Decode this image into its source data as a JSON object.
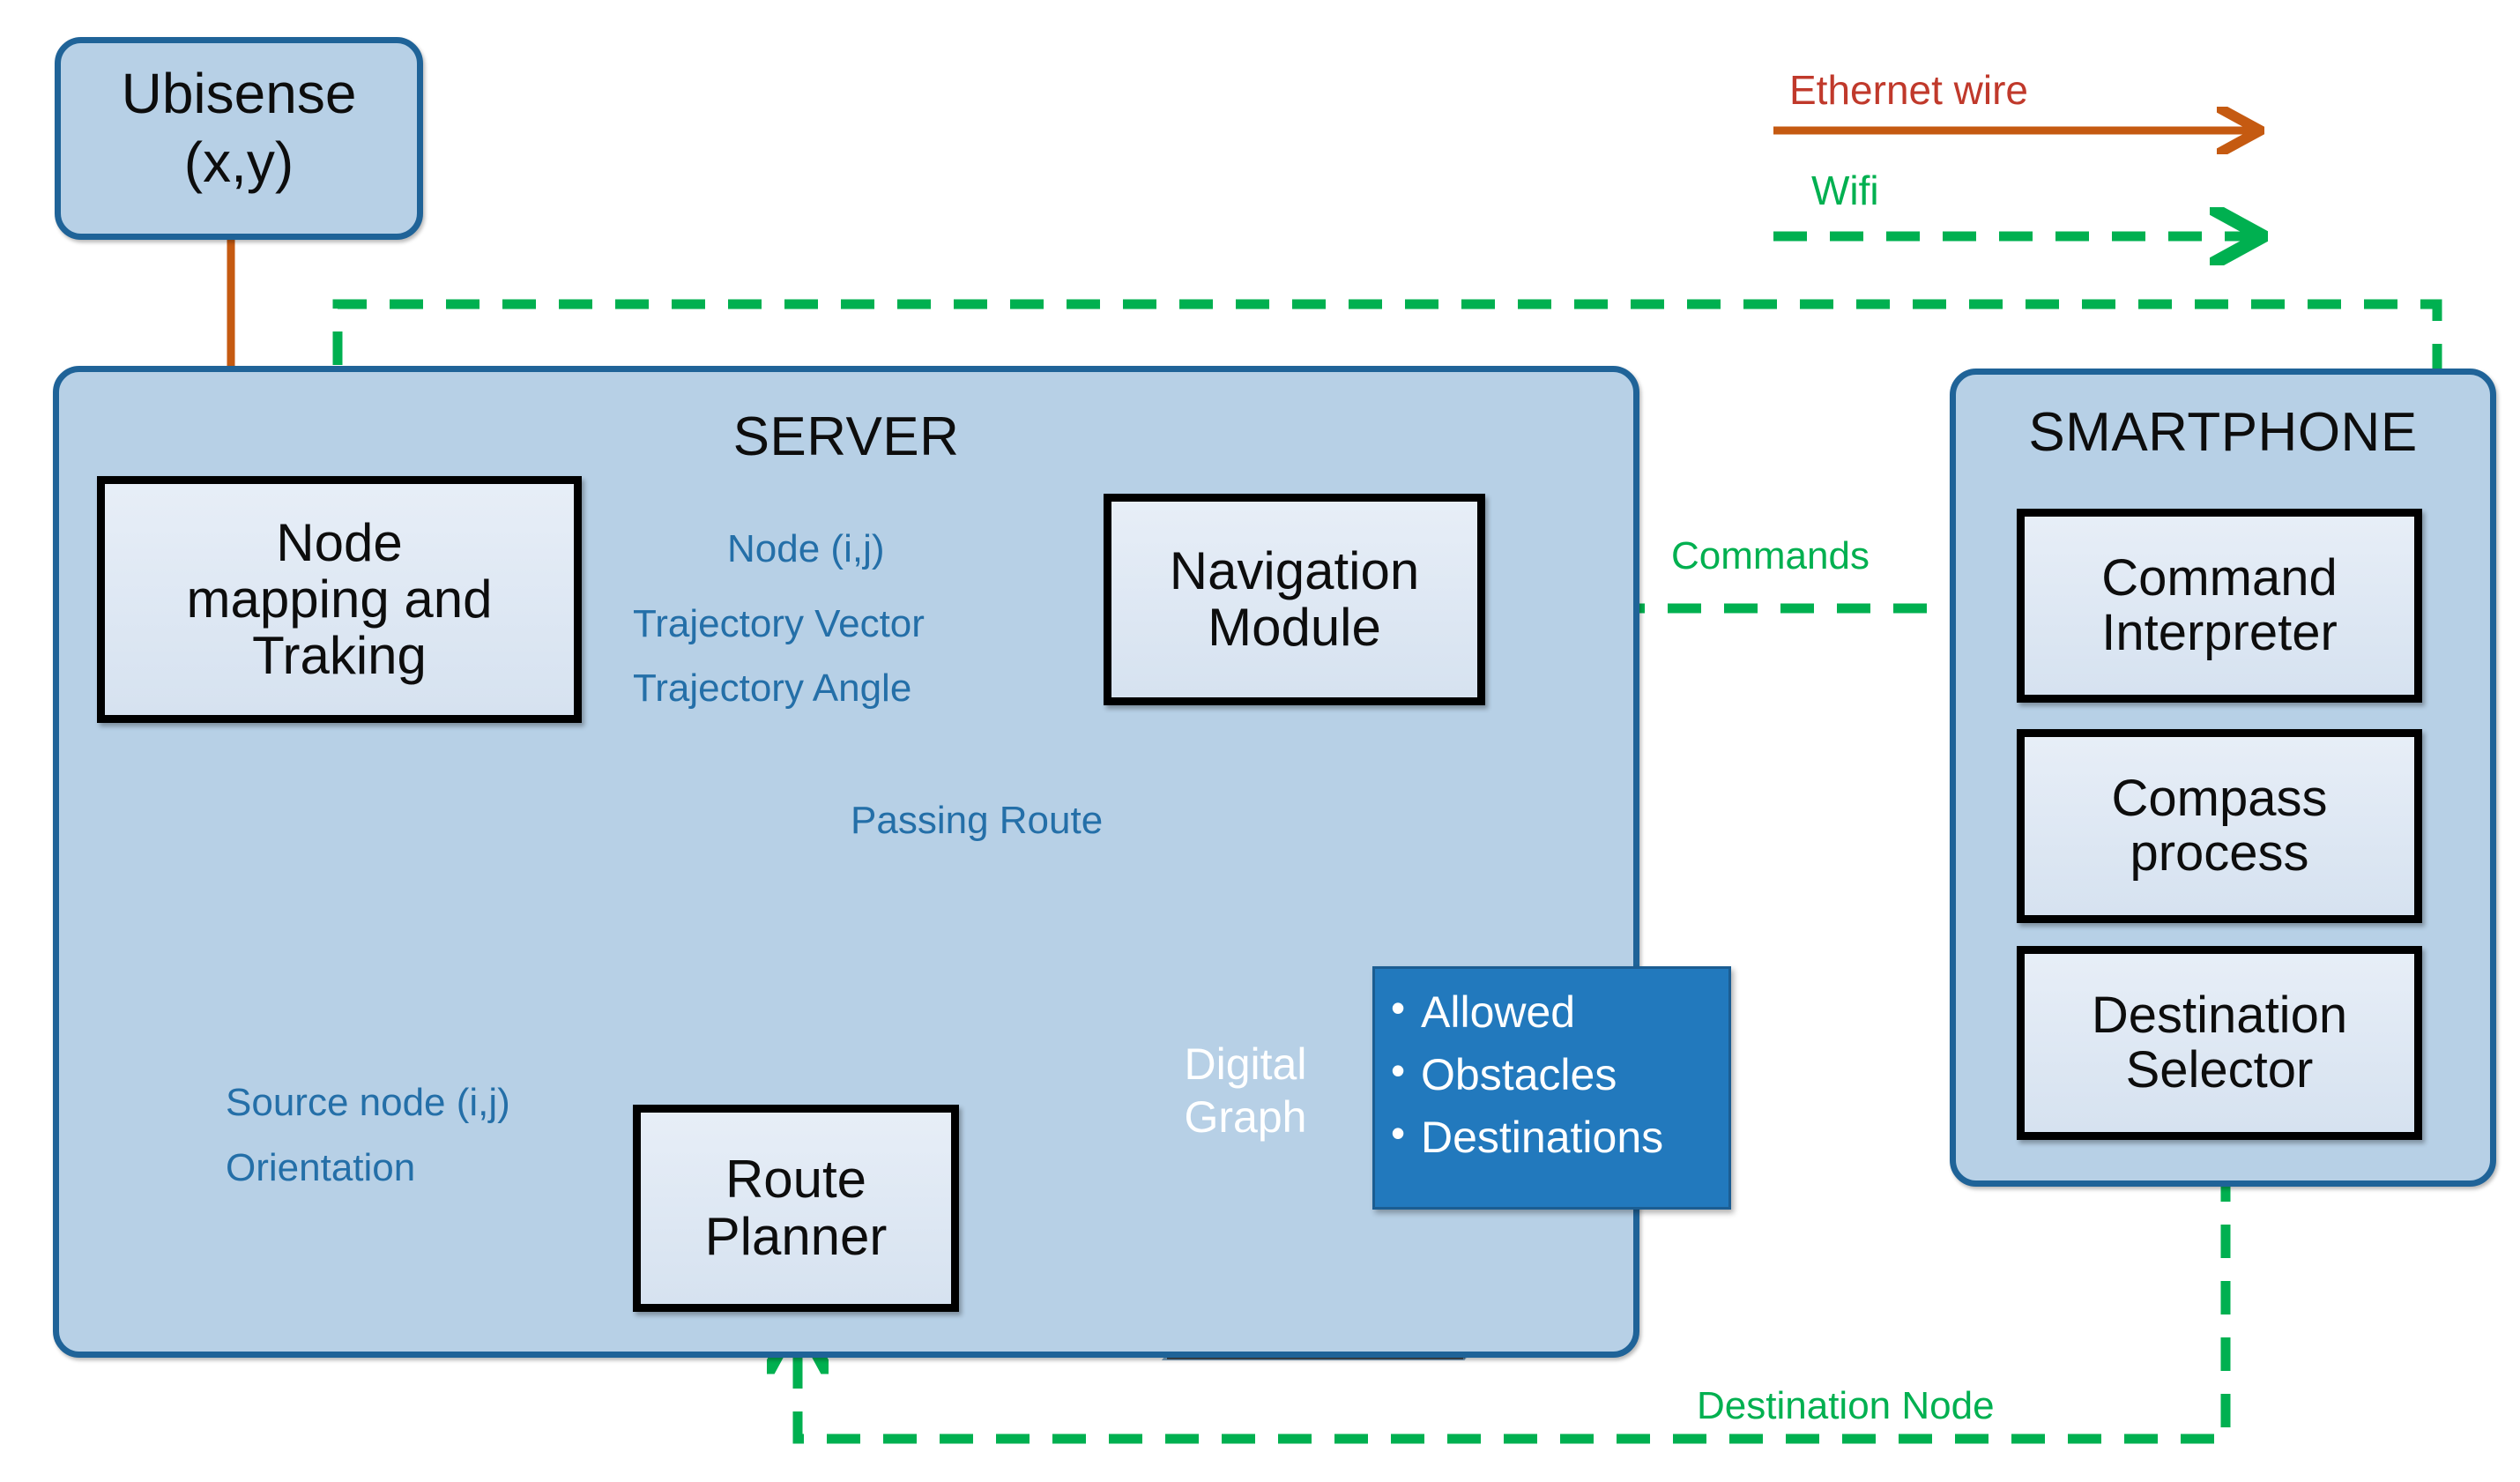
{
  "legend": {
    "ethernet_label": "Ethernet wire",
    "wifi_label": "Wifi",
    "ethernet_color": "#c0392b",
    "ethernet_line_color": "#c55a11",
    "wifi_color": "#00b050"
  },
  "ubisense": {
    "title": "Ubisense",
    "subtitle": "(x,y)"
  },
  "server": {
    "title": "SERVER",
    "boxes": [
      {
        "id": "node-mapping",
        "lines": [
          "Node",
          "mapping and",
          "Traking"
        ]
      },
      {
        "id": "navigation-module",
        "lines": [
          "Navigation",
          "Module"
        ]
      },
      {
        "id": "route-planner",
        "lines": [
          "Route",
          "Planner"
        ]
      }
    ],
    "database": {
      "line1": "Digital",
      "line2": "Graph",
      "callout_items": [
        "Allowed",
        "Obstacles",
        "Destinations"
      ]
    },
    "flow_labels": {
      "node_ij": "Node (i,j)",
      "trajectory_vector": "Trajectory Vector",
      "trajectory_angle": "Trajectory Angle",
      "passing_route": "Passing Route",
      "source_node": "Source node (i,j)",
      "orientation": "Orientation"
    }
  },
  "smartphone": {
    "title": "SMARTPHONE",
    "boxes": [
      {
        "id": "command-interpreter",
        "lines": [
          "Command",
          "Interpreter"
        ]
      },
      {
        "id": "compass-process",
        "lines": [
          "Compass",
          "process"
        ]
      },
      {
        "id": "destination-selector",
        "lines": [
          "Destination",
          "Selector"
        ]
      }
    ]
  },
  "wireless_labels": {
    "commands": "Commands",
    "destination_node": "Destination Node"
  },
  "colors": {
    "panel_fill": "#b7d0e6",
    "panel_border": "#1f6398",
    "box_fill": "#dde7f2",
    "box_border": "#000000",
    "blue_flow": "#2e8ccf",
    "red_flow": "#ff0000",
    "green_wifi": "#00b050",
    "orange_eth": "#c55a11",
    "db_fill": "#2279bd"
  }
}
